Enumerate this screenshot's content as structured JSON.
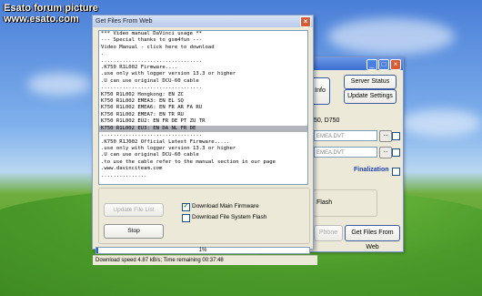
{
  "watermark": {
    "line1": "Esato forum picture",
    "line2": "www.esato.com"
  },
  "background_window": {
    "buttons": {
      "info": "Info",
      "server_status": "Server Status",
      "update_settings": "Update Settings",
      "phone": "Phone",
      "get_files": "Get Files From Web"
    },
    "models_text": "50, D750",
    "field1_value": "EMEA.DVT",
    "field2_value": "EMEA.DVT",
    "dots_label": "...",
    "finalization_label": "Finalization",
    "flash_label": "Flash"
  },
  "dialog": {
    "title": "Get Files From Web",
    "log_lines": [
      "*** Video manual DaVinci usage **",
      "--- Special thanks to gsm4fun ---",
      "Video Manual - click here to download",
      ".",
      ".................................",
      ".K750 R1L002 Firmware....",
      ".use only with logger version 13.3 or higher",
      ".U can use original DCU-60 cable",
      ".................................",
      "K750 R1L002 Hongkong: EN ZC",
      "K750 R1L002 EMEA3: EN EL SQ",
      "K750 R1L002 EMEA6: EN FR AR FA RU",
      "K750 R1L002 EMEA7: EN TR RU",
      "K750 R1L002 EU2: EN FR DE PT ZU TR",
      "K750 R1L002 EU3: EN DA NL FR DE",
      ".................................",
      ".K750 R1J002 Official Latest Firmware.....",
      ".use only with logger version 13.3 or higher",
      ".U can use original DCU-60 cable",
      ".to use the cable refer to the manual section in our page",
      ".www.davinciteam.com",
      "..............."
    ],
    "selected_line_index": 14,
    "update_file_list_label": "Update File List",
    "stop_label": "Stop",
    "download_main_firmware_label": "Download Main Firmware",
    "download_file_system_flash_label": "Download File System Flash",
    "download_main_firmware_checked": true,
    "download_file_system_flash_checked": false,
    "progress_percent": 1,
    "progress_text": "1%",
    "status_text": "Download speed 4.87 kB/s; Time remaining 00:37:48"
  },
  "colors": {
    "progress_fill": "#2f5ec9",
    "finalization_text": "#1a3fb0"
  }
}
